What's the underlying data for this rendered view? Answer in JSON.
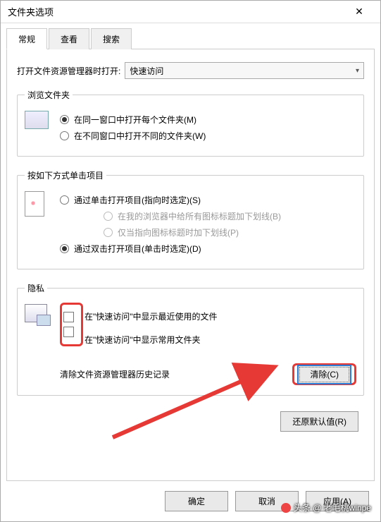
{
  "title": "文件夹选项",
  "tabs": {
    "general": "常规",
    "view": "查看",
    "search": "搜索"
  },
  "open_with_label": "打开文件资源管理器时打开:",
  "open_with_value": "快速访问",
  "browse": {
    "legend": "浏览文件夹",
    "same_window": "在同一窗口中打开每个文件夹(M)",
    "new_window": "在不同窗口中打开不同的文件夹(W)"
  },
  "click": {
    "legend": "按如下方式单击项目",
    "single": "通过单击打开项目(指向时选定)(S)",
    "underline_all": "在我的浏览器中给所有图标标题加下划线(B)",
    "underline_point": "仅当指向图标标题时加下划线(P)",
    "double": "通过双击打开项目(单击时选定)(D)"
  },
  "privacy": {
    "legend": "隐私",
    "recent_files": "在\"快速访问\"中显示最近使用的文件",
    "frequent_folders": "在\"快速访问\"中显示常用文件夹",
    "clear_label": "清除文件资源管理器历史记录",
    "clear_btn": "清除(C)"
  },
  "restore_btn": "还原默认值(R)",
  "footer": {
    "ok": "确定",
    "cancel": "取消",
    "apply": "应用(A)"
  },
  "watermark": "头条 @ 老毛桃winpe"
}
